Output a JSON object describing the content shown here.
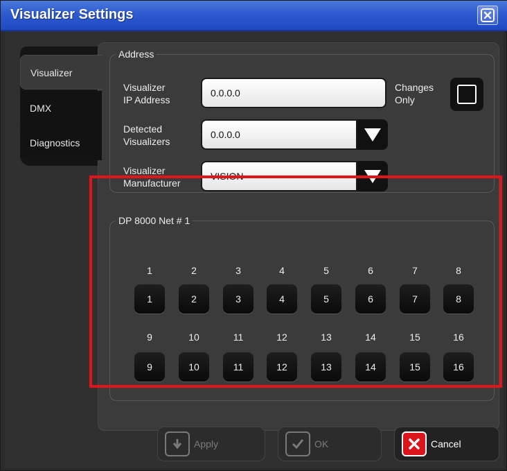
{
  "window": {
    "title": "Visualizer Settings"
  },
  "tabs": [
    {
      "label": "Visualizer"
    },
    {
      "label": "DMX"
    },
    {
      "label": "Diagnostics"
    }
  ],
  "address": {
    "legend": "Address",
    "ip_label_line1": "Visualizer",
    "ip_label_line2": "IP Address",
    "ip_value": "0.0.0.0",
    "changes_only_line1": "Changes",
    "changes_only_line2": "Only",
    "changes_only_checked": false,
    "detected_label_line1": "Detected",
    "detected_label_line2": "Visualizers",
    "detected_value": "0.0.0.0",
    "manufacturer_label_line1": "Visualizer",
    "manufacturer_label_line2": "Manufacturer",
    "manufacturer_value": "VISION"
  },
  "net": {
    "legend": "DP 8000 Net # 1",
    "row1_numbers": [
      "1",
      "2",
      "3",
      "4",
      "5",
      "6",
      "7",
      "8"
    ],
    "row1_buttons": [
      "1",
      "2",
      "3",
      "4",
      "5",
      "6",
      "7",
      "8"
    ],
    "row2_numbers": [
      "9",
      "10",
      "11",
      "12",
      "13",
      "14",
      "15",
      "16"
    ],
    "row2_buttons": [
      "9",
      "10",
      "11",
      "12",
      "13",
      "14",
      "15",
      "16"
    ]
  },
  "actions": {
    "apply_label": "Apply",
    "ok_label": "OK",
    "cancel_label": "Cancel"
  },
  "colors": {
    "titlebar": "#2e5bd0",
    "highlight": "#e0141a",
    "cancel_icon": "#d8161c"
  }
}
